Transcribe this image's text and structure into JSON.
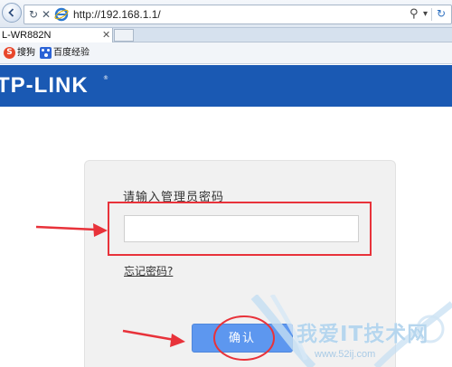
{
  "browser": {
    "url": "http://192.168.1.1/",
    "tab_title": "L-WR882N",
    "favorites": [
      {
        "label": "搜狗",
        "icon": "sogou-icon"
      },
      {
        "label": "百度经验",
        "icon": "baidu-paw-icon"
      }
    ]
  },
  "header": {
    "logo_text": "TP-LINK",
    "logo_mark": "®",
    "brand_color": "#1a59b3"
  },
  "login": {
    "password_label": "请输入管理员密码",
    "password_value": "",
    "forgot_link": "忘记密码?",
    "confirm_button": "确认",
    "button_color": "#5d97ef"
  },
  "annotation": {
    "color": "#e8323a",
    "items": [
      "red-box-around-password-input",
      "arrow-to-password-input",
      "arrow-to-confirm-button",
      "circle-around-confirm-button"
    ]
  },
  "watermark": {
    "text": "我爱IT技术网",
    "url": "www.52ij.com"
  }
}
